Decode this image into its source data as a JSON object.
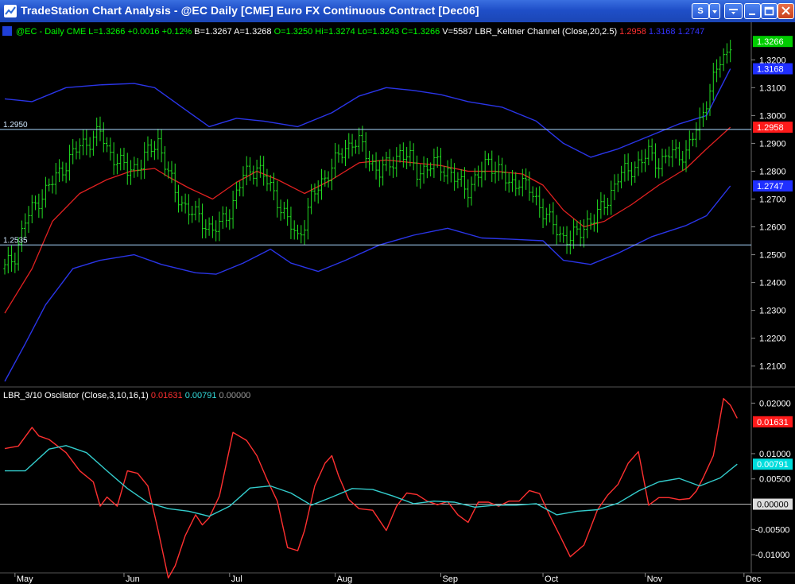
{
  "window": {
    "title": "TradeStation Chart Analysis - @EC  Daily  [CME] Euro FX Continuous Contract [Dec06]",
    "buttons": [
      "S",
      "",
      "",
      "",
      ""
    ]
  },
  "price_header": [
    {
      "text": "@EC - Daily",
      "color": "#00ff00"
    },
    {
      "text": "CME",
      "color": "#00ff00"
    },
    {
      "text": "L=1.3266",
      "color": "#00ff00"
    },
    {
      "text": "+0.0016",
      "color": "#00ff00"
    },
    {
      "text": "+0.12%",
      "color": "#00ff00"
    },
    {
      "text": "B=1.3267",
      "color": "#ffffff"
    },
    {
      "text": "A=1.3268",
      "color": "#ffffff"
    },
    {
      "text": "O=1.3250",
      "color": "#00ff00"
    },
    {
      "text": "Hi=1.3274",
      "color": "#00ff00"
    },
    {
      "text": "Lo=1.3243",
      "color": "#00ff00"
    },
    {
      "text": "C=1.3266",
      "color": "#00ff00"
    },
    {
      "text": "V=5587",
      "color": "#ffffff"
    },
    {
      "text": "LBR_Keltner Channel",
      "color": "#ffffff"
    },
    {
      "text": "(Close,20,2.5)",
      "color": "#ffffff"
    },
    {
      "text": "1.2958",
      "color": "#ff3030"
    },
    {
      "text": "1.3168",
      "color": "#3333ff"
    },
    {
      "text": "1.2747",
      "color": "#3333ff"
    }
  ],
  "osc_header": [
    {
      "text": "LBR_3/10 Oscilator",
      "color": "#ffffff"
    },
    {
      "text": "(Close,3,10,16,1)",
      "color": "#ffffff"
    },
    {
      "text": "0.01631",
      "color": "#ff3030"
    },
    {
      "text": "0.00791",
      "color": "#33dddd"
    },
    {
      "text": "0.00000",
      "color": "#999999"
    }
  ],
  "chart_data": [
    {
      "type": "ohlc",
      "title": "@EC - Daily",
      "ylim": [
        1.2025,
        1.3335
      ],
      "y_ticks": [
        "1.3200",
        "1.3100",
        "1.3000",
        "1.2900",
        "1.2800",
        "1.2700",
        "1.2600",
        "1.2500",
        "1.2400",
        "1.2300",
        "1.2200",
        "1.2100"
      ],
      "x_labels": [
        "May",
        "Jun",
        "Jul",
        "Aug",
        "Sep",
        "Oct",
        "Nov",
        "Dec"
      ],
      "horizontal_lines": [
        {
          "label": "1.2950",
          "value": 1.295
        },
        {
          "label": "1.2535",
          "value": 1.2535
        }
      ],
      "last_value_tags": [
        {
          "text": "1.3266",
          "value": 1.3266,
          "color": "#00cc00"
        },
        {
          "text": "1.3168",
          "value": 1.3168,
          "color": "#1f2fff"
        },
        {
          "text": "1.2958",
          "value": 1.2958,
          "color": "#ff1a1a"
        },
        {
          "text": "1.2747",
          "value": 1.2747,
          "color": "#1f2fff"
        }
      ],
      "bars_anchor_closes": [
        [
          0,
          1.245
        ],
        [
          3,
          1.25
        ],
        [
          6,
          1.262
        ],
        [
          10,
          1.27
        ],
        [
          14,
          1.276
        ],
        [
          18,
          1.283
        ],
        [
          22,
          1.289
        ],
        [
          26,
          1.292
        ],
        [
          28,
          1.294
        ],
        [
          30,
          1.288
        ],
        [
          33,
          1.284
        ],
        [
          36,
          1.28
        ],
        [
          40,
          1.283
        ],
        [
          43,
          1.288
        ],
        [
          45,
          1.291
        ],
        [
          47,
          1.283
        ],
        [
          50,
          1.272
        ],
        [
          54,
          1.266
        ],
        [
          58,
          1.262
        ],
        [
          61,
          1.259
        ],
        [
          63,
          1.26
        ],
        [
          66,
          1.266
        ],
        [
          70,
          1.278
        ],
        [
          74,
          1.282
        ],
        [
          76,
          1.278
        ],
        [
          80,
          1.27
        ],
        [
          83,
          1.262
        ],
        [
          86,
          1.256
        ],
        [
          88,
          1.262
        ],
        [
          90,
          1.27
        ],
        [
          94,
          1.278
        ],
        [
          98,
          1.285
        ],
        [
          102,
          1.291
        ],
        [
          104,
          1.29
        ],
        [
          107,
          1.284
        ],
        [
          110,
          1.28
        ],
        [
          113,
          1.282
        ],
        [
          116,
          1.287
        ],
        [
          119,
          1.284
        ],
        [
          121,
          1.28
        ],
        [
          124,
          1.281
        ],
        [
          127,
          1.283
        ],
        [
          130,
          1.28
        ],
        [
          133,
          1.276
        ],
        [
          136,
          1.274
        ],
        [
          139,
          1.278
        ],
        [
          142,
          1.284
        ],
        [
          145,
          1.28
        ],
        [
          148,
          1.275
        ],
        [
          151,
          1.277
        ],
        [
          154,
          1.273
        ],
        [
          157,
          1.268
        ],
        [
          160,
          1.262
        ],
        [
          163,
          1.257
        ],
        [
          166,
          1.256
        ],
        [
          169,
          1.258
        ],
        [
          171,
          1.262
        ],
        [
          174,
          1.264
        ],
        [
          177,
          1.27
        ],
        [
          180,
          1.278
        ],
        [
          183,
          1.28
        ],
        [
          186,
          1.283
        ],
        [
          189,
          1.286
        ],
        [
          192,
          1.283
        ],
        [
          195,
          1.286
        ],
        [
          198,
          1.286
        ],
        [
          200,
          1.287
        ],
        [
          202,
          1.292
        ],
        [
          204,
          1.297
        ],
        [
          206,
          1.306
        ],
        [
          208,
          1.313
        ],
        [
          210,
          1.319
        ],
        [
          212,
          1.322
        ],
        [
          213,
          1.3266
        ]
      ],
      "mid_line": [
        [
          0,
          1.229
        ],
        [
          8,
          1.245
        ],
        [
          14,
          1.262
        ],
        [
          22,
          1.272
        ],
        [
          30,
          1.277
        ],
        [
          37,
          1.28
        ],
        [
          44,
          1.281
        ],
        [
          48,
          1.278
        ],
        [
          54,
          1.274
        ],
        [
          61,
          1.27
        ],
        [
          68,
          1.276
        ],
        [
          74,
          1.28
        ],
        [
          80,
          1.277
        ],
        [
          88,
          1.272
        ],
        [
          96,
          1.277
        ],
        [
          104,
          1.283
        ],
        [
          112,
          1.284
        ],
        [
          120,
          1.283
        ],
        [
          128,
          1.282
        ],
        [
          136,
          1.28
        ],
        [
          144,
          1.28
        ],
        [
          152,
          1.279
        ],
        [
          158,
          1.275
        ],
        [
          164,
          1.266
        ],
        [
          170,
          1.26
        ],
        [
          176,
          1.262
        ],
        [
          184,
          1.268
        ],
        [
          192,
          1.275
        ],
        [
          200,
          1.281
        ],
        [
          206,
          1.288
        ],
        [
          213,
          1.2958
        ]
      ],
      "upper_band": [
        [
          0,
          1.306
        ],
        [
          8,
          1.305
        ],
        [
          18,
          1.31
        ],
        [
          28,
          1.311
        ],
        [
          38,
          1.3115
        ],
        [
          44,
          1.31
        ],
        [
          52,
          1.303
        ],
        [
          60,
          1.296
        ],
        [
          68,
          1.299
        ],
        [
          76,
          1.298
        ],
        [
          86,
          1.296
        ],
        [
          96,
          1.301
        ],
        [
          104,
          1.307
        ],
        [
          112,
          1.31
        ],
        [
          120,
          1.309
        ],
        [
          128,
          1.3075
        ],
        [
          136,
          1.305
        ],
        [
          146,
          1.303
        ],
        [
          156,
          1.298
        ],
        [
          164,
          1.29
        ],
        [
          172,
          1.285
        ],
        [
          180,
          1.288
        ],
        [
          190,
          1.293
        ],
        [
          198,
          1.297
        ],
        [
          206,
          1.3
        ],
        [
          213,
          1.3168
        ]
      ],
      "lower_band": [
        [
          0,
          1.2045
        ],
        [
          6,
          1.218
        ],
        [
          12,
          1.232
        ],
        [
          20,
          1.245
        ],
        [
          28,
          1.248
        ],
        [
          38,
          1.25
        ],
        [
          46,
          1.2465
        ],
        [
          56,
          1.2435
        ],
        [
          62,
          1.243
        ],
        [
          70,
          1.247
        ],
        [
          78,
          1.252
        ],
        [
          84,
          1.247
        ],
        [
          92,
          1.244
        ],
        [
          100,
          1.248
        ],
        [
          110,
          1.2535
        ],
        [
          120,
          1.257
        ],
        [
          130,
          1.2595
        ],
        [
          140,
          1.256
        ],
        [
          150,
          1.2555
        ],
        [
          158,
          1.255
        ],
        [
          164,
          1.248
        ],
        [
          172,
          1.2465
        ],
        [
          180,
          1.2505
        ],
        [
          190,
          1.2565
        ],
        [
          200,
          1.2605
        ],
        [
          206,
          1.264
        ],
        [
          213,
          1.2747
        ]
      ]
    },
    {
      "type": "line",
      "title": "LBR_3/10 Oscilator",
      "ylim": [
        -0.0136,
        0.0232
      ],
      "y_ticks": [
        "0.02000",
        "0.01000",
        "0.00500",
        "-0.00500",
        "-0.01000"
      ],
      "zero_tag": {
        "text": "0.00000",
        "value": 0.0,
        "color": "#dddddd"
      },
      "last_value_tags": [
        {
          "text": "0.01631",
          "value": 0.01631,
          "color": "#ff1a1a"
        },
        {
          "text": "0.00791",
          "value": 0.00791,
          "color": "#00dddd"
        }
      ],
      "series": [
        {
          "name": "",
          "color": "#ff3030",
          "points": [
            [
              0,
              0.011
            ],
            [
              4,
              0.0115
            ],
            [
              8,
              0.0152
            ],
            [
              10,
              0.0135
            ],
            [
              13,
              0.0128
            ],
            [
              18,
              0.0102
            ],
            [
              22,
              0.0066
            ],
            [
              26,
              0.0044
            ],
            [
              28,
              -0.0004
            ],
            [
              30,
              0.0014
            ],
            [
              33,
              -0.0004
            ],
            [
              36,
              0.0066
            ],
            [
              39,
              0.0061
            ],
            [
              42,
              0.0036
            ],
            [
              45,
              -0.0051
            ],
            [
              48,
              -0.0146
            ],
            [
              50,
              -0.0122
            ],
            [
              53,
              -0.0062
            ],
            [
              56,
              -0.0021
            ],
            [
              58,
              -0.0041
            ],
            [
              60,
              -0.0027
            ],
            [
              63,
              0.0016
            ],
            [
              67,
              0.0142
            ],
            [
              71,
              0.0126
            ],
            [
              74,
              0.0096
            ],
            [
              77,
              0.0049
            ],
            [
              80,
              0.0006
            ],
            [
              83,
              -0.0086
            ],
            [
              86,
              -0.0092
            ],
            [
              88,
              -0.0052
            ],
            [
              91,
              0.0036
            ],
            [
              94,
              0.0081
            ],
            [
              96,
              0.0096
            ],
            [
              98,
              0.0056
            ],
            [
              101,
              0.0009
            ],
            [
              104,
              -0.0009
            ],
            [
              108,
              -0.0012
            ],
            [
              112,
              -0.0052
            ],
            [
              115,
              -0.0004
            ],
            [
              118,
              0.0022
            ],
            [
              121,
              0.0019
            ],
            [
              124,
              0.0006
            ],
            [
              127,
              -0.0001
            ],
            [
              130,
              0.0005
            ],
            [
              133,
              -0.0021
            ],
            [
              136,
              -0.0036
            ],
            [
              139,
              0.0004
            ],
            [
              142,
              0.0004
            ],
            [
              145,
              -0.0004
            ],
            [
              148,
              0.0006
            ],
            [
              151,
              0.0006
            ],
            [
              154,
              0.0027
            ],
            [
              157,
              0.0021
            ],
            [
              160,
              -0.0023
            ],
            [
              163,
              -0.0063
            ],
            [
              166,
              -0.0104
            ],
            [
              170,
              -0.0081
            ],
            [
              174,
              -0.0011
            ],
            [
              177,
              0.0018
            ],
            [
              180,
              0.0039
            ],
            [
              183,
              0.0081
            ],
            [
              186,
              0.0104
            ],
            [
              189,
              -0.0002
            ],
            [
              192,
              0.0013
            ],
            [
              195,
              0.0013
            ],
            [
              198,
              0.0009
            ],
            [
              201,
              0.0011
            ],
            [
              203,
              0.0026
            ],
            [
              205,
              0.0052
            ],
            [
              208,
              0.0096
            ],
            [
              211,
              0.0209
            ],
            [
              213,
              0.0196
            ],
            [
              215,
              0.017
            ]
          ]
        },
        {
          "name": "",
          "color": "#33cccc",
          "points": [
            [
              0,
              0.0066
            ],
            [
              6,
              0.0066
            ],
            [
              13,
              0.0109
            ],
            [
              18,
              0.0116
            ],
            [
              24,
              0.0102
            ],
            [
              30,
              0.0066
            ],
            [
              36,
              0.0031
            ],
            [
              42,
              0.0003
            ],
            [
              48,
              -0.0009
            ],
            [
              54,
              -0.0014
            ],
            [
              60,
              -0.0024
            ],
            [
              66,
              -0.0004
            ],
            [
              72,
              0.0032
            ],
            [
              78,
              0.0036
            ],
            [
              84,
              0.0022
            ],
            [
              90,
              -0.0002
            ],
            [
              96,
              0.0014
            ],
            [
              102,
              0.0031
            ],
            [
              108,
              0.0029
            ],
            [
              114,
              0.0016
            ],
            [
              120,
              0.0001
            ],
            [
              126,
              0.0006
            ],
            [
              132,
              0.0004
            ],
            [
              138,
              -0.0006
            ],
            [
              144,
              -0.0002
            ],
            [
              150,
              -0.0002
            ],
            [
              156,
              0.0001
            ],
            [
              162,
              -0.0021
            ],
            [
              168,
              -0.0014
            ],
            [
              174,
              -0.0011
            ],
            [
              180,
              0.0002
            ],
            [
              186,
              0.0026
            ],
            [
              192,
              0.0044
            ],
            [
              198,
              0.0051
            ],
            [
              204,
              0.0036
            ],
            [
              210,
              0.0052
            ],
            [
              215,
              0.00791
            ]
          ]
        }
      ]
    }
  ]
}
